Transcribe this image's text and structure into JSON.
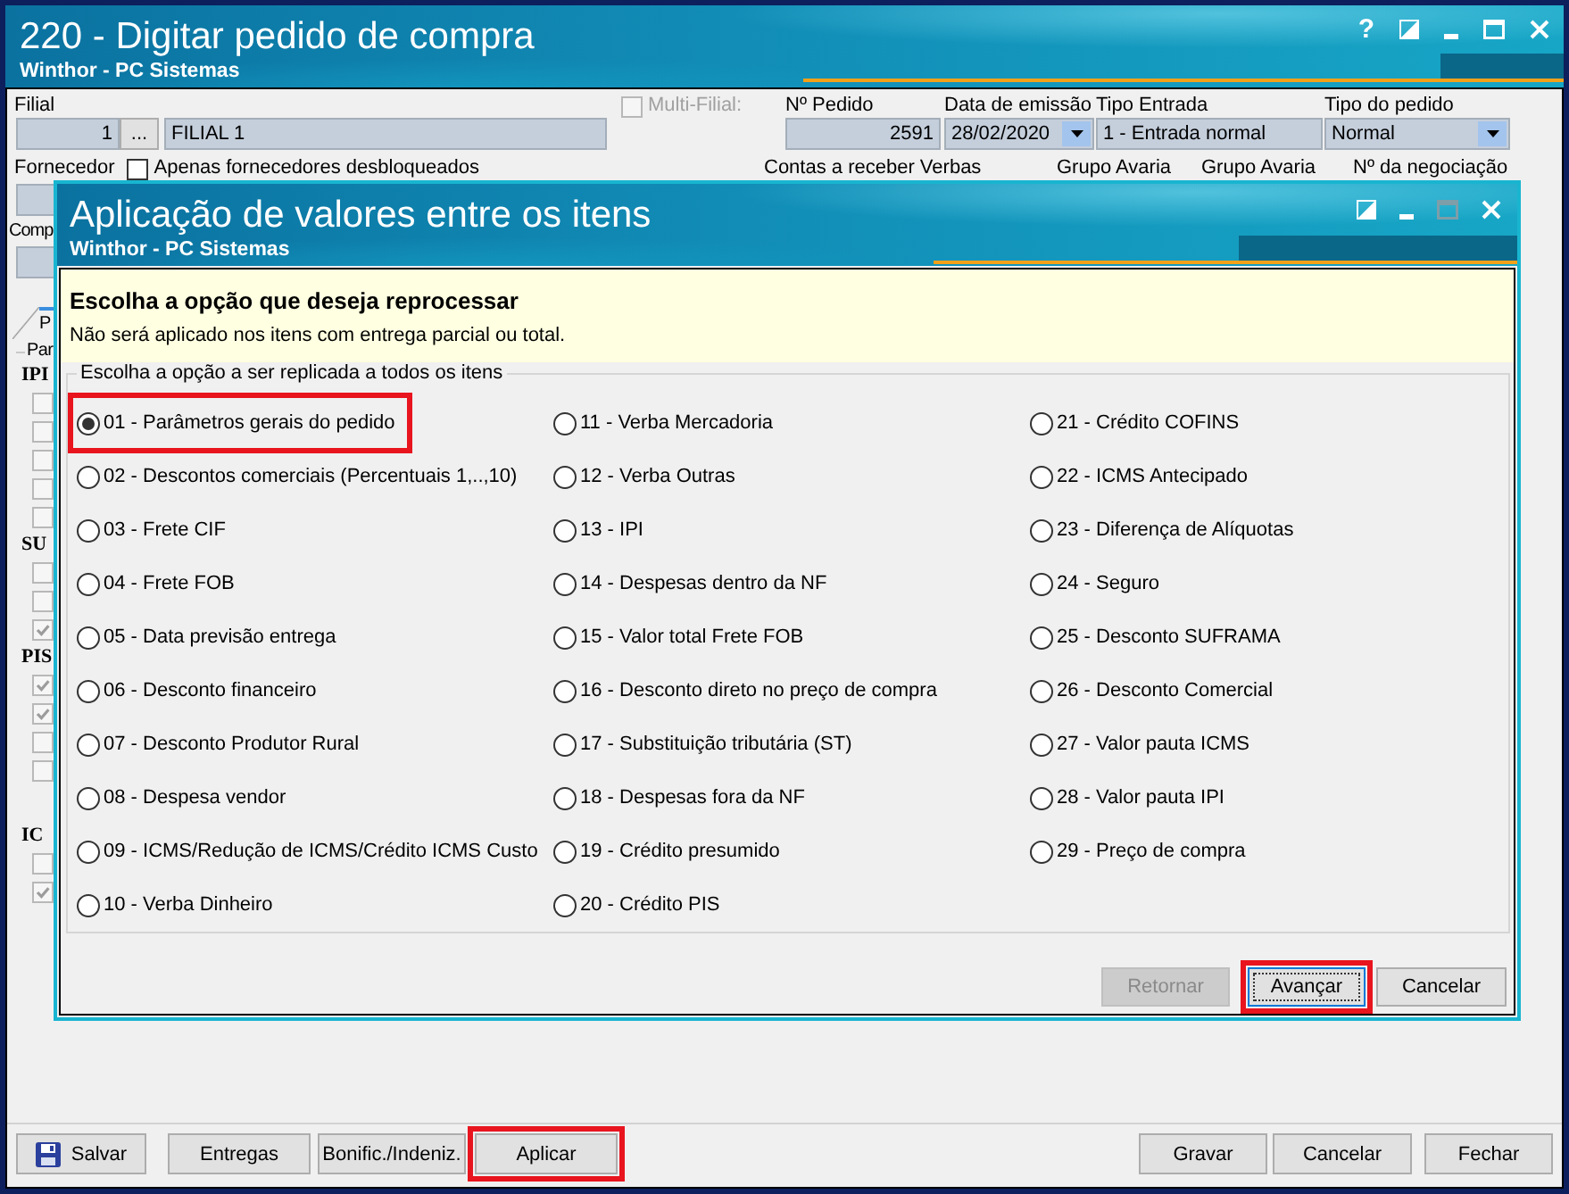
{
  "window": {
    "title": "220 - Digitar pedido de compra",
    "subtitle": "Winthor - PC Sistemas",
    "controls": [
      {
        "kind": "help",
        "label": "?"
      },
      {
        "kind": "theme"
      },
      {
        "kind": "minimize"
      },
      {
        "kind": "maximize"
      },
      {
        "kind": "close"
      }
    ]
  },
  "form": {
    "filial": {
      "label": "Filial",
      "code": "1",
      "browse": "...",
      "name": "FILIAL 1"
    },
    "multi_filial": {
      "label": "Multi-Filial:",
      "checked": false,
      "disabled": true
    },
    "fields": [
      {
        "label": "Nº Pedido",
        "value": "2591",
        "kind": "number"
      },
      {
        "label": "Data de emissão",
        "value": "28/02/2020",
        "kind": "dropdown"
      },
      {
        "label": "Tipo Entrada",
        "value": "1 - Entrada normal",
        "kind": "text"
      },
      {
        "label": "Tipo do pedido",
        "value": "Normal",
        "kind": "dropdown"
      }
    ],
    "fornecedor": {
      "label": "Fornecedor",
      "filter": {
        "label": "Apenas fornecedores desbloqueados",
        "checked": false
      }
    },
    "column_labels": [
      "Contas a receber Verbas",
      "Grupo Avaria",
      "Grupo Avaria",
      "Nº da negociação"
    ],
    "comprador": {
      "label": "Comp"
    }
  },
  "tabs": [
    {
      "label": "P",
      "selected": true
    }
  ],
  "parameters": {
    "legend": "Par",
    "sections": [
      {
        "title": "IPI",
        "checkboxes": [
          {
            "checked": false,
            "disabled": true
          },
          {
            "checked": false,
            "disabled": true
          },
          {
            "checked": false,
            "disabled": true
          },
          {
            "checked": false,
            "disabled": true
          },
          {
            "checked": false,
            "disabled": true
          }
        ]
      },
      {
        "title": "SU",
        "checkboxes": [
          {
            "checked": false,
            "disabled": true
          },
          {
            "checked": false,
            "disabled": true
          },
          {
            "checked": true,
            "disabled": true
          }
        ]
      },
      {
        "title": "PIS",
        "checkboxes": [
          {
            "checked": true,
            "disabled": true
          },
          {
            "checked": true,
            "disabled": true
          },
          {
            "checked": false,
            "disabled": true
          },
          {
            "checked": false,
            "disabled": true
          }
        ]
      },
      {
        "title": "IC",
        "checkboxes": [
          {
            "checked": false,
            "disabled": true
          },
          {
            "checked": true,
            "disabled": true
          }
        ]
      }
    ]
  },
  "dialog": {
    "title": "Aplicação de valores entre os itens",
    "subtitle": "Winthor - PC Sistemas",
    "controls": [
      {
        "kind": "theme",
        "disabled": false
      },
      {
        "kind": "minimize",
        "disabled": false
      },
      {
        "kind": "maximize",
        "disabled": true
      },
      {
        "kind": "close",
        "disabled": false
      }
    ],
    "heading": "Escolha a opção que deseja reprocessar",
    "note": "Não será aplicado nos itens com entrega parcial ou total.",
    "group_label": "Escolha a opção a ser replicada a todos os itens",
    "options": [
      {
        "label": "01 - Parâmetros gerais do pedido",
        "selected": true,
        "highlighted": true
      },
      {
        "label": "02 - Descontos comerciais (Percentuais 1,..,10)",
        "selected": false,
        "highlighted": false
      },
      {
        "label": "03 - Frete CIF",
        "selected": false,
        "highlighted": false
      },
      {
        "label": "04 - Frete FOB",
        "selected": false,
        "highlighted": false
      },
      {
        "label": "05 - Data previsão entrega",
        "selected": false,
        "highlighted": false
      },
      {
        "label": "06 - Desconto financeiro",
        "selected": false,
        "highlighted": false
      },
      {
        "label": "07 - Desconto Produtor Rural",
        "selected": false,
        "highlighted": false
      },
      {
        "label": "08 - Despesa vendor",
        "selected": false,
        "highlighted": false
      },
      {
        "label": "09 - ICMS/Redução de ICMS/Crédito ICMS Custo",
        "selected": false,
        "highlighted": false
      },
      {
        "label": "10 - Verba Dinheiro",
        "selected": false,
        "highlighted": false
      },
      {
        "label": "11 - Verba Mercadoria",
        "selected": false,
        "highlighted": false
      },
      {
        "label": "12 - Verba Outras",
        "selected": false,
        "highlighted": false
      },
      {
        "label": "13 - IPI",
        "selected": false,
        "highlighted": false
      },
      {
        "label": "14 - Despesas dentro da NF",
        "selected": false,
        "highlighted": false
      },
      {
        "label": "15 - Valor total Frete FOB",
        "selected": false,
        "highlighted": false
      },
      {
        "label": "16 - Desconto direto no preço de compra",
        "selected": false,
        "highlighted": false
      },
      {
        "label": "17 - Substituição tributária (ST)",
        "selected": false,
        "highlighted": false
      },
      {
        "label": "18 - Despesas fora da NF",
        "selected": false,
        "highlighted": false
      },
      {
        "label": "19 - Crédito presumido",
        "selected": false,
        "highlighted": false
      },
      {
        "label": "20 - Crédito PIS",
        "selected": false,
        "highlighted": false
      },
      {
        "label": "21 - Crédito COFINS",
        "selected": false,
        "highlighted": false
      },
      {
        "label": "22 - ICMS Antecipado",
        "selected": false,
        "highlighted": false
      },
      {
        "label": "23 - Diferença de Alíquotas",
        "selected": false,
        "highlighted": false
      },
      {
        "label": "24 - Seguro",
        "selected": false,
        "highlighted": false
      },
      {
        "label": "25 - Desconto SUFRAMA",
        "selected": false,
        "highlighted": false
      },
      {
        "label": "26 - Desconto Comercial",
        "selected": false,
        "highlighted": false
      },
      {
        "label": "27 - Valor pauta ICMS",
        "selected": false,
        "highlighted": false
      },
      {
        "label": "28 - Valor pauta IPI",
        "selected": false,
        "highlighted": false
      },
      {
        "label": "29 - Preço de compra",
        "selected": false,
        "highlighted": false
      }
    ],
    "buttons": [
      {
        "label": "Retornar",
        "disabled": true,
        "focused": false,
        "highlighted": false
      },
      {
        "label": "Avançar",
        "disabled": false,
        "focused": true,
        "highlighted": true
      },
      {
        "label": "Cancelar",
        "disabled": false,
        "focused": false,
        "highlighted": false
      }
    ]
  },
  "actions": {
    "left": [
      {
        "label": "Salvar",
        "kind": "icon",
        "highlighted": false
      },
      {
        "label": "Entregas",
        "kind": "plain",
        "highlighted": false
      },
      {
        "label": "Bonific./Indeniz.",
        "kind": "plain",
        "highlighted": false
      },
      {
        "label": "Aplicar",
        "kind": "plain",
        "highlighted": true
      }
    ],
    "right": [
      {
        "label": "Gravar",
        "kind": "plain",
        "highlighted": false
      },
      {
        "label": "Cancelar",
        "kind": "plain",
        "highlighted": false
      },
      {
        "label": "Fechar",
        "kind": "plain",
        "highlighted": false
      }
    ]
  }
}
